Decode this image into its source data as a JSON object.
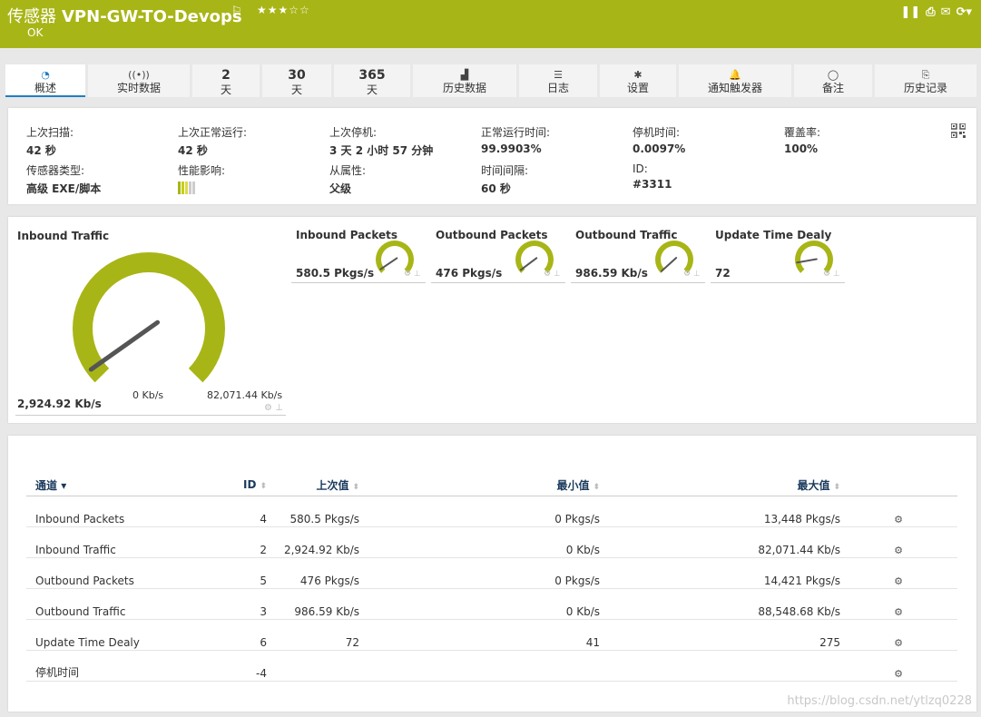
{
  "header": {
    "sensor_type": "传感器",
    "sensor_name": "VPN-GW-TO-Devops",
    "flag_icon": "flag-icon",
    "stars": "★★★☆☆",
    "status": "OK",
    "tools": [
      "pause-icon",
      "export-icon",
      "mail-icon",
      "refresh-icon"
    ]
  },
  "tabs": [
    {
      "label": "概述",
      "icon": "◔",
      "active": true
    },
    {
      "label": "实时数据",
      "icon": "((•))"
    },
    {
      "big": "2",
      "label": "天"
    },
    {
      "big": "30",
      "label": "天"
    },
    {
      "big": "365",
      "label": "天"
    },
    {
      "label": "历史数据",
      "icon": "▟"
    },
    {
      "label": "日志",
      "icon": "☰"
    },
    {
      "label": "设置",
      "icon": "✱"
    },
    {
      "label": "通知触发器",
      "icon": "🔔"
    },
    {
      "label": "备注",
      "icon": "◯"
    },
    {
      "label": "历史记录",
      "icon": "⎘"
    }
  ],
  "info": {
    "last_scan": {
      "label": "上次扫描:",
      "value": "42 秒"
    },
    "last_up": {
      "label": "上次正常运行:",
      "value": "42 秒"
    },
    "last_down": {
      "label": "上次停机:",
      "value": "3 天 2 小时 57 分钟"
    },
    "uptime": {
      "label": "正常运行时间:",
      "value": "99.9903%"
    },
    "downtime": {
      "label": "停机时间:",
      "value": "0.0097%"
    },
    "coverage": {
      "label": "覆盖率:",
      "value": "100%"
    },
    "sensor_type": {
      "label": "传感器类型:",
      "value": "高级 EXE/脚本"
    },
    "impact": {
      "label": "性能影响:",
      "level": 3
    },
    "dependency": {
      "label": "从属性:",
      "value": "父级"
    },
    "interval": {
      "label": "时间间隔:",
      "value": "60 秒"
    },
    "id": {
      "label": "ID:",
      "value": "#3311"
    }
  },
  "main_gauge": {
    "title": "Inbound Traffic",
    "value": "2,924.92 Kb/s",
    "min": "0 Kb/s",
    "max": "82,071.44 Kb/s",
    "fraction": 0.036,
    "color": "#a8b516"
  },
  "small_gauges": [
    {
      "title": "Inbound Packets",
      "value": "580.5 Pkgs/s",
      "fraction": 0.04
    },
    {
      "title": "Outbound Packets",
      "value": "476 Pkgs/s",
      "fraction": 0.03
    },
    {
      "title": "Outbound Traffic",
      "value": "986.59 Kb/s",
      "fraction": 0.01
    },
    {
      "title": "Update Time Dealy",
      "value": "72",
      "fraction": 0.13
    }
  ],
  "table": {
    "headers": {
      "channel": "通道",
      "id": "ID",
      "last": "上次值",
      "min": "最小值",
      "max": "最大值"
    },
    "rows": [
      {
        "name": "Inbound Packets",
        "id": "4",
        "last": "580.5 Pkgs/s",
        "min": "0 Pkgs/s",
        "max": "13,448 Pkgs/s"
      },
      {
        "name": "Inbound Traffic",
        "id": "2",
        "last": "2,924.92 Kb/s",
        "min": "0 Kb/s",
        "max": "82,071.44 Kb/s"
      },
      {
        "name": "Outbound Packets",
        "id": "5",
        "last": "476 Pkgs/s",
        "min": "0 Pkgs/s",
        "max": "14,421 Pkgs/s"
      },
      {
        "name": "Outbound Traffic",
        "id": "3",
        "last": "986.59 Kb/s",
        "min": "0 Kb/s",
        "max": "88,548.68 Kb/s"
      },
      {
        "name": "Update Time Dealy",
        "id": "6",
        "last": "72",
        "min": "41",
        "max": "275"
      },
      {
        "name": "停机时间",
        "id": "-4",
        "last": "",
        "min": "",
        "max": ""
      }
    ]
  },
  "watermark": "https://blog.csdn.net/ytlzq0228"
}
